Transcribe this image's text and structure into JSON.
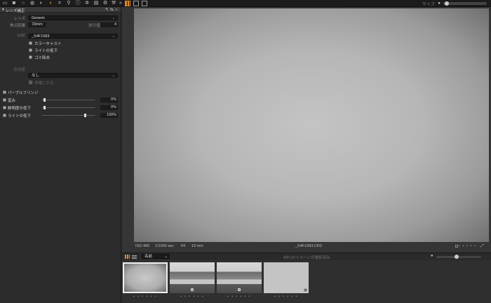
{
  "toolbar": {
    "icons": [
      "folder-icon",
      "camera-icon",
      "search-icon",
      "color-icon",
      "exposure-icon",
      "lens-icon",
      "crop-icon",
      "details-icon",
      "info-icon",
      "adjust-icon",
      "batch-icon",
      "settings-icon",
      "tools-icon",
      "more-icon"
    ],
    "size_label": "サイズ"
  },
  "lens_panel": {
    "title": "レンズ補正",
    "lens_label": "レンズ",
    "lens_value": "Generic",
    "focal_label": "焦点距離",
    "focal_value": "19mm",
    "aperture_label": "絞り値",
    "aperture_value": "4",
    "lcc_label": "LCC",
    "lcc_value": "_S4F1583",
    "lcc_options": [
      "カラーキャスト",
      "ライトの低下",
      "ゴミ除去"
    ],
    "color_label": "色収差",
    "color_value": "なし",
    "color_option": "非増にする",
    "purple_fringe": "パープルフリンジ",
    "sliders": [
      {
        "label": "歪み",
        "value": "0%",
        "level": 0
      },
      {
        "label": "鮮明度の低下",
        "value": "0%",
        "level": 0
      },
      {
        "label": "ライトの低下",
        "value": "100%",
        "level": 100
      }
    ]
  },
  "viewer": {
    "iso": "ISO 400",
    "shutter": "1/1000 sec",
    "aperture": "f/4",
    "focal": "19 mm",
    "filename": "_S4F1583.CR2"
  },
  "browser": {
    "sort_value": "名前",
    "status": "4中1のイメージが選択済み"
  },
  "colors": {
    "accent": "#e08a2a",
    "panel_bg": "#2c2c2c",
    "toolbar_bg": "#1c1c1c"
  }
}
